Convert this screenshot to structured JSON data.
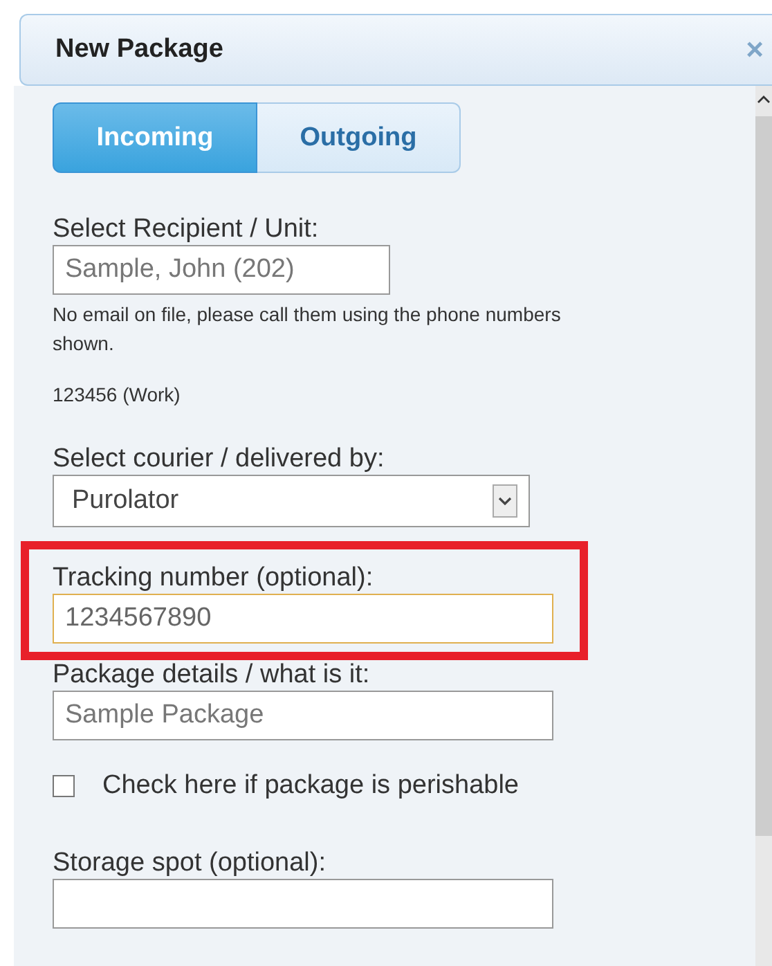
{
  "dialog": {
    "title": "New Package",
    "close": "×"
  },
  "tabs": [
    {
      "label": "Incoming",
      "selected": true
    },
    {
      "label": "Outgoing",
      "selected": false
    }
  ],
  "recipient": {
    "label": "Select Recipient / Unit:",
    "value": "Sample, John (202)"
  },
  "notice": "No email on file, please call them using the phone numbers shown.",
  "phone": "123456 (Work)",
  "courier": {
    "label": "Select courier / delivered by:",
    "value": "Purolator"
  },
  "tracking": {
    "label": "Tracking number (optional):",
    "value": "1234567890",
    "highlighted": true
  },
  "details": {
    "label": "Package details / what is it:",
    "value": "Sample Package"
  },
  "perishable": {
    "label": "Check here if package is perishable",
    "checked": false
  },
  "storage": {
    "label": "Storage spot (optional):"
  }
}
